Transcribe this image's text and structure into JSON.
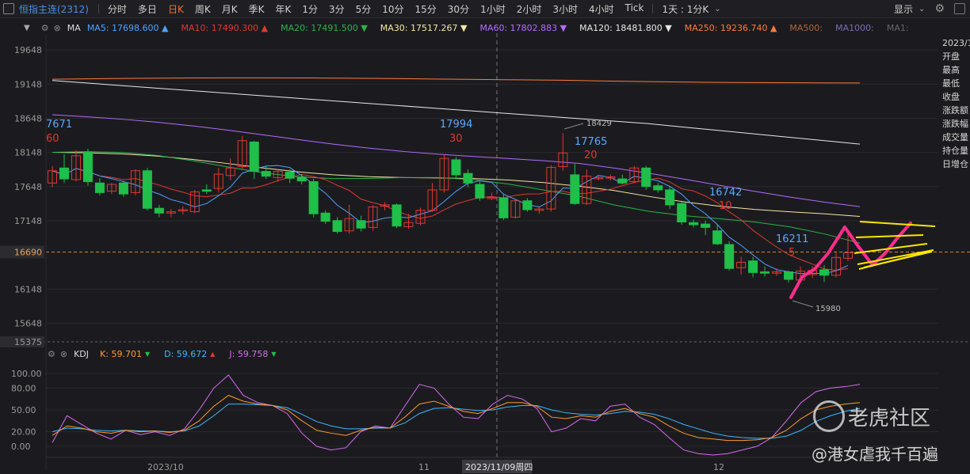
{
  "toolbar": {
    "title": "恒指主连(2312)",
    "timeframes": [
      "分时",
      "多日",
      "日K",
      "周K",
      "月K",
      "季K",
      "年K",
      "1分",
      "3分",
      "5分",
      "10分",
      "15分",
      "30分",
      "1小时",
      "2小时",
      "3小时",
      "4小时",
      "Tick"
    ],
    "active_timeframe": "日K",
    "custom_period": "1天 : 1分K",
    "display_label": "显示"
  },
  "ma_legend": {
    "label": "MA",
    "items": [
      {
        "name": "MA5",
        "value": "17698.600",
        "dir": "▲",
        "color": "#4da3ff"
      },
      {
        "name": "MA10",
        "value": "17490.300",
        "dir": "▲",
        "color": "#e0382f"
      },
      {
        "name": "MA20",
        "value": "17491.500",
        "dir": "▼",
        "color": "#2bb34a"
      },
      {
        "name": "MA30",
        "value": "17517.267",
        "dir": "▼",
        "color": "#f5e6a8"
      },
      {
        "name": "MA60",
        "value": "17802.883",
        "dir": "▼",
        "color": "#b36bff"
      },
      {
        "name": "MA120",
        "value": "18481.800",
        "dir": "▼",
        "color": "#e8e8e8"
      },
      {
        "name": "MA250",
        "value": "19236.740",
        "dir": "▲",
        "color": "#ff7a3c"
      },
      {
        "name": "MA500",
        "value": "",
        "dir": "",
        "color": "#b0643a"
      },
      {
        "name": "MA1000",
        "value": "",
        "dir": "",
        "color": "#7a6bb0"
      },
      {
        "name": "MA1",
        "value": "",
        "dir": "",
        "color": "#666666"
      }
    ]
  },
  "price_axis": [
    "19648",
    "19148",
    "18648",
    "18148",
    "17648",
    "17148",
    "16690",
    "16148",
    "15648",
    "15375"
  ],
  "current_price": "16690",
  "kdj_legend": {
    "label": "KDJ",
    "k": "K: 59.701",
    "k_dir": "▼",
    "d": "D: 59.672",
    "d_dir": "▲",
    "j": "J: 59.758",
    "j_dir": "▼"
  },
  "kdj_axis": [
    "100.00",
    "80.00",
    "50.00",
    "20.00",
    "0.00"
  ],
  "date_axis": [
    "2023/10",
    "11",
    "2023/11/09周四",
    "12"
  ],
  "annotations": {
    "a1_price": "7671",
    "a1_day": "60",
    "a2_price": "17994",
    "a2_day": "30",
    "a3_price": "17765",
    "a3_day": "20",
    "a4_price": "16742",
    "a4_day": "10",
    "a5_price": "16211",
    "a5_day": "5",
    "high_label": "18429",
    "low_label": "15980"
  },
  "side_panel": {
    "date": "2023/1",
    "rows": [
      "开盘",
      "最高",
      "最低",
      "收盘",
      "涨跌额",
      "涨跌幅",
      "成交量",
      "持仓量",
      "日增仓"
    ]
  },
  "watermark": {
    "brand": "老虎社区",
    "author": "@港女虐我千百遍"
  },
  "colors": {
    "up": "#e0382f",
    "down": "#1fbf4a",
    "bg": "#1b1b1f",
    "accent": "#ff6b2c",
    "drawing_pink": "#ff2d8a",
    "drawing_yellow": "#ffe600"
  }
}
